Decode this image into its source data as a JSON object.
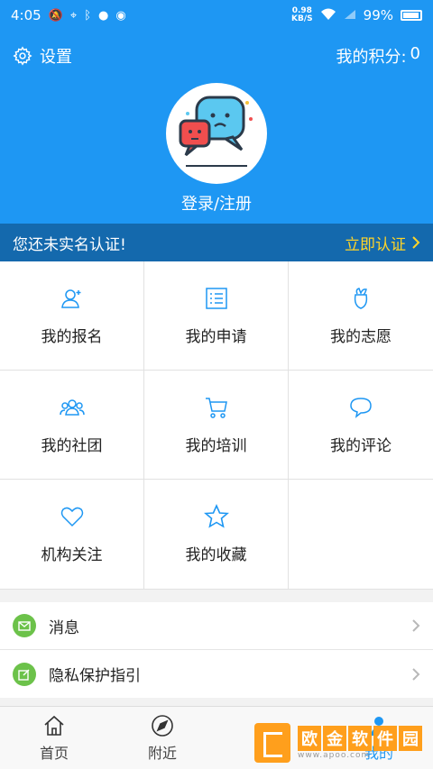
{
  "status": {
    "time": "4:05",
    "speed_value": "0.98",
    "speed_unit": "KB/S",
    "battery": "99%"
  },
  "header": {
    "settings_label": "设置",
    "points_label": "我的积分:",
    "points_value": "0",
    "login_label": "登录/注册"
  },
  "verify": {
    "message": "您还未实名认证!",
    "action": "立即认证"
  },
  "grid": {
    "items": [
      {
        "label": "我的报名",
        "icon": "user-plus-icon"
      },
      {
        "label": "我的申请",
        "icon": "list-icon"
      },
      {
        "label": "我的志愿",
        "icon": "flower-icon"
      },
      {
        "label": "我的社团",
        "icon": "group-icon"
      },
      {
        "label": "我的培训",
        "icon": "cart-icon"
      },
      {
        "label": "我的评论",
        "icon": "comment-icon"
      },
      {
        "label": "机构关注",
        "icon": "heart-icon"
      },
      {
        "label": "我的收藏",
        "icon": "star-icon"
      }
    ]
  },
  "list": {
    "items": [
      {
        "label": "消息",
        "icon": "mail-icon"
      },
      {
        "label": "隐私保护指引",
        "icon": "edit-icon"
      }
    ]
  },
  "tabbar": {
    "tabs": [
      {
        "label": "首页",
        "icon": "home-icon"
      },
      {
        "label": "附近",
        "icon": "navigate-icon"
      },
      {
        "label": "",
        "icon": "document-icon"
      },
      {
        "label": "我的",
        "icon": "person-icon"
      }
    ]
  },
  "watermark": {
    "title": [
      "欧",
      "金",
      "软",
      "件",
      "园"
    ],
    "url": "www.apoo.com"
  },
  "colors": {
    "primary": "#1e97f3",
    "verify_bg": "#1469ad",
    "verify_accent": "#ffd428",
    "list_icon": "#6cc24a"
  }
}
